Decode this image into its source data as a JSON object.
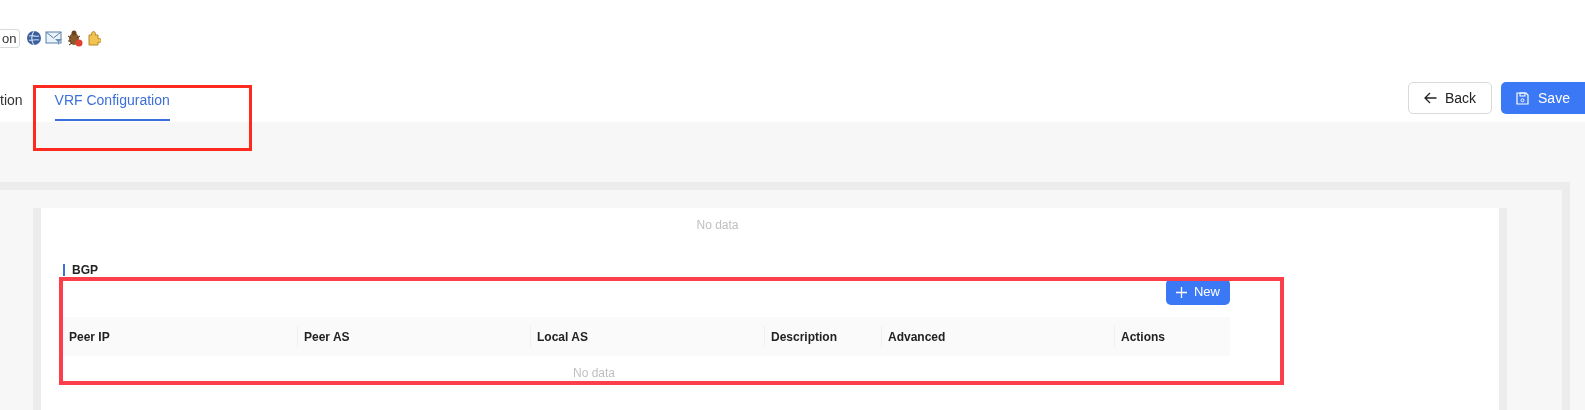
{
  "toolbar": {
    "button_label": "on"
  },
  "tabs": [
    {
      "label": "tion",
      "selected": false
    },
    {
      "label": "VRF Configuration",
      "selected": true
    }
  ],
  "actions": [
    {
      "kind": "back",
      "label": "Back"
    },
    {
      "kind": "save",
      "label": "Save"
    }
  ],
  "first_table": {
    "empty_text": "No data"
  },
  "bgp": {
    "title": "BGP",
    "new_button": "New",
    "columns": [
      "Peer IP",
      "Peer AS",
      "Local AS",
      "Description",
      "Advanced",
      "Actions"
    ],
    "empty_text": "No data"
  },
  "annotations": [
    {
      "color": "#ff2a1f"
    },
    {
      "color": "#fb3e4a"
    }
  ]
}
